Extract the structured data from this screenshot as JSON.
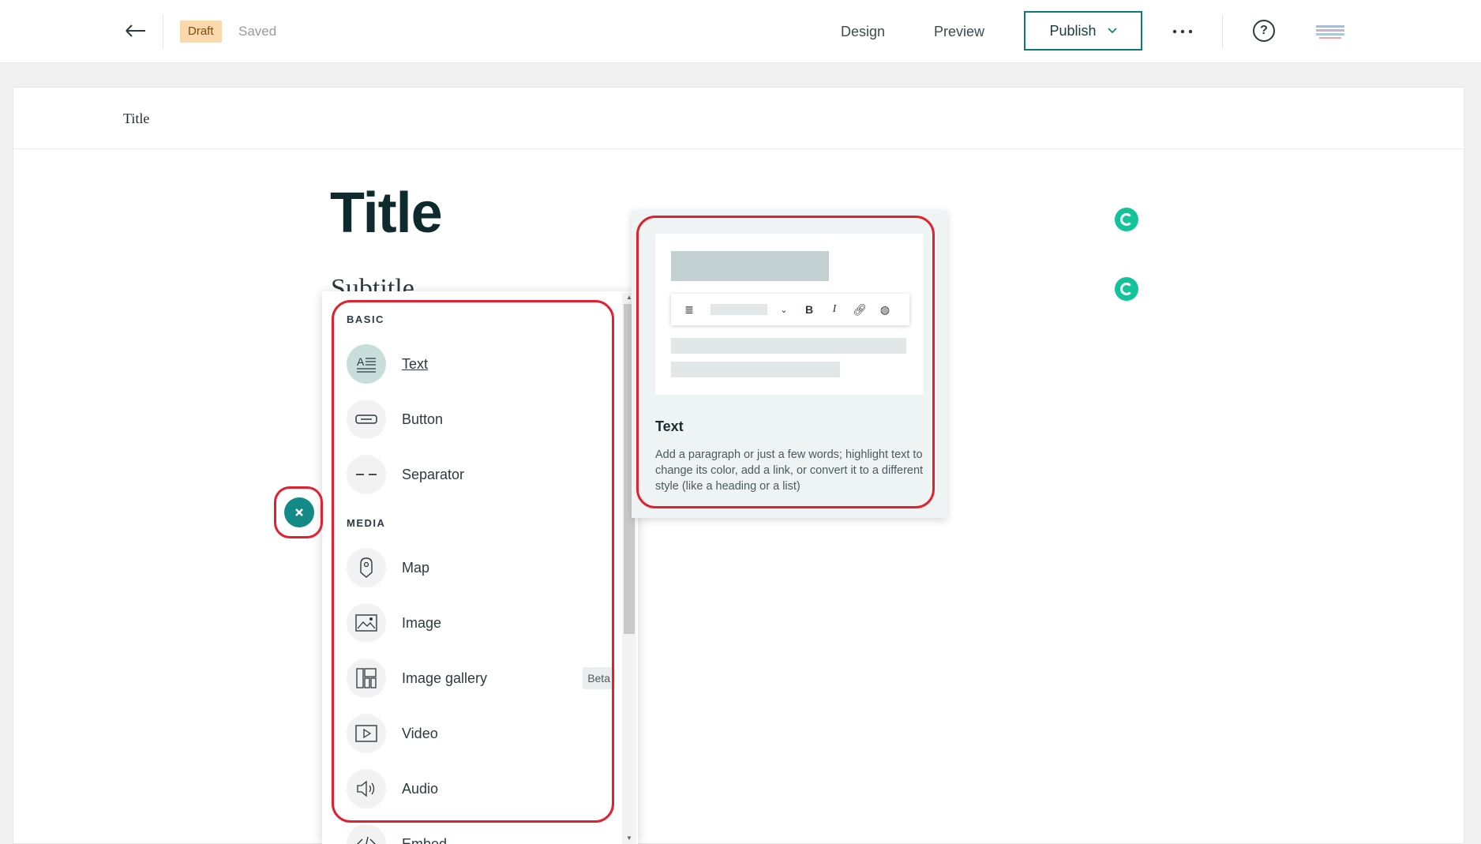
{
  "topbar": {
    "status_badge": "Draft",
    "save_status": "Saved",
    "design_label": "Design",
    "preview_label": "Preview",
    "publish_label": "Publish"
  },
  "canvas": {
    "header_title": "Title",
    "story_title": "Title",
    "story_subtitle": "Subtitle"
  },
  "block_menu": {
    "sections": [
      {
        "label": "BASIC",
        "items": [
          {
            "label": "Text",
            "icon": "text-block-icon",
            "active": true
          },
          {
            "label": "Button",
            "icon": "button-block-icon"
          },
          {
            "label": "Separator",
            "icon": "separator-block-icon"
          }
        ]
      },
      {
        "label": "MEDIA",
        "items": [
          {
            "label": "Map",
            "icon": "map-pin-icon"
          },
          {
            "label": "Image",
            "icon": "image-icon"
          },
          {
            "label": "Image gallery",
            "icon": "image-gallery-icon",
            "badge": "Beta"
          },
          {
            "label": "Video",
            "icon": "video-icon"
          },
          {
            "label": "Audio",
            "icon": "audio-icon"
          },
          {
            "label": "Embed",
            "icon": "embed-icon"
          }
        ]
      }
    ]
  },
  "preview": {
    "title": "Text",
    "description": "Add a paragraph or just a few words; highlight text to change its color, add a link, or convert it to a different style (like a heading or a list)"
  },
  "colors": {
    "accent": "#138a86",
    "highlight": "#e0212f",
    "draft_badge": "#fbd7ac",
    "grammarly": "#15c39a"
  }
}
